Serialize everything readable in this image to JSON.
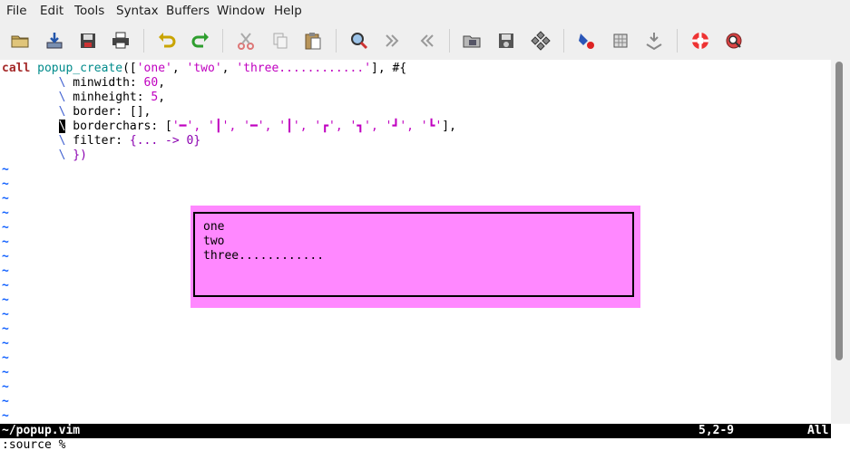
{
  "menu": [
    "File",
    "Edit",
    "Tools",
    "Syntax",
    "Buffers",
    "Window",
    "Help"
  ],
  "toolbar": [
    "open-file",
    "save-download",
    "save",
    "print",
    "undo",
    "redo",
    "cut",
    "copy",
    "paste",
    "find-replace",
    "find-next",
    "find-prev",
    "load-session",
    "save-session",
    "run-script",
    "make",
    "build-tags",
    "jump-tag",
    "help",
    "find-help"
  ],
  "code": {
    "l1": {
      "kw": "call",
      "fn": "popup_create",
      "p1": "([",
      "s1": "'one'",
      "c1": ", ",
      "s2": "'two'",
      "c2": ", ",
      "s3": "'three............'",
      "p2": "], #{"
    },
    "l2": {
      "bs": "\\",
      "key": " minwidth: ",
      "num": "60",
      "tail": ","
    },
    "l3": {
      "bs": "\\",
      "key": " minheight: ",
      "num": "5",
      "tail": ","
    },
    "l4": {
      "bs": "\\",
      "key": " border: [],"
    },
    "l5": {
      "bs": "\\",
      "key": " borderchars: [",
      "chars": "'━', '┃', '━', '┃', '┏', '┓', '┛', '┗'",
      "tail": "],"
    },
    "l6": {
      "bs": "\\",
      "key": " filter: ",
      "lam": "{... -> 0}"
    },
    "l7": {
      "bs": "\\",
      "close": " })"
    }
  },
  "tilde_char": "~",
  "popup": {
    "lines": [
      "one",
      "two",
      "three............"
    ]
  },
  "status": {
    "file": "~/popup.vim",
    "position": "5,2-9",
    "scroll": "All"
  },
  "command": ":source %"
}
